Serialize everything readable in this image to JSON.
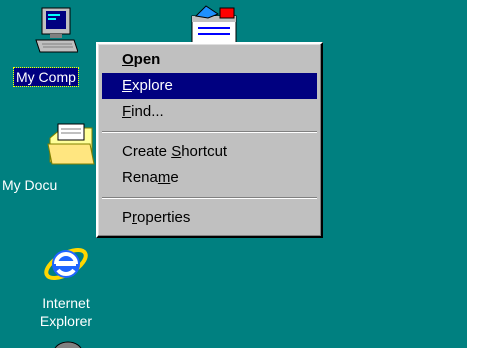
{
  "colors": {
    "desktop": "#008080",
    "menu_bg": "#c0c0c0",
    "selection": "#000080",
    "label_text": "#ffffff"
  },
  "desktop_icons": {
    "my_computer": {
      "label": "My Comp",
      "icon": "computer-icon",
      "selected": true
    },
    "inbox": {
      "icon": "inbox-icon"
    },
    "my_documents": {
      "label": "My Docu",
      "icon": "folder-icon"
    },
    "internet_explorer": {
      "label_line1": "Internet",
      "label_line2": "Explorer",
      "icon": "internet-explorer-icon"
    },
    "bottom_partial": {
      "icon": "recycle-bin-icon"
    }
  },
  "context_menu": {
    "items": [
      {
        "pre": "",
        "u": "O",
        "post": "pen",
        "bold": true,
        "selected": false
      },
      {
        "pre": "",
        "u": "E",
        "post": "xplore",
        "bold": false,
        "selected": true
      },
      {
        "pre": "",
        "u": "F",
        "post": "ind...",
        "bold": false,
        "selected": false
      },
      {
        "pre": "Create ",
        "u": "S",
        "post": "hortcut",
        "bold": false,
        "selected": false
      },
      {
        "pre": "Rena",
        "u": "m",
        "post": "e",
        "bold": false,
        "selected": false
      },
      {
        "pre": "P",
        "u": "r",
        "post": "operties",
        "bold": false,
        "selected": false
      }
    ]
  }
}
